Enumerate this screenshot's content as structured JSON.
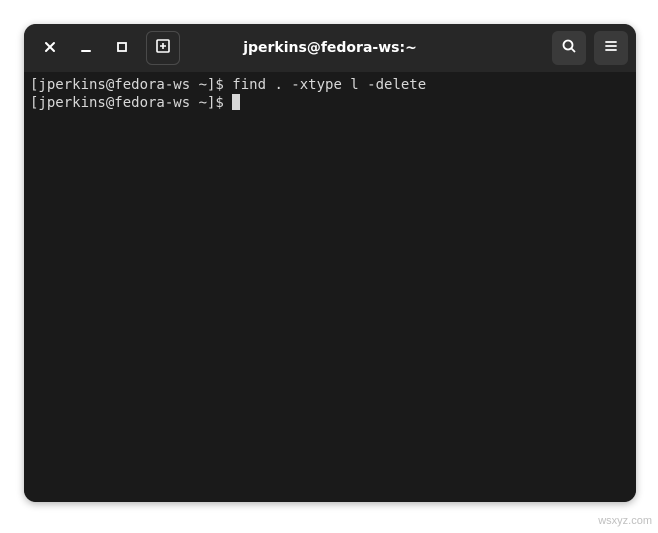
{
  "window": {
    "title": "jperkins@fedora-ws:~"
  },
  "terminal": {
    "lines": [
      {
        "prompt": "[jperkins@fedora-ws ~]$ ",
        "command": "find . -xtype l -delete"
      },
      {
        "prompt": "[jperkins@fedora-ws ~]$ ",
        "command": ""
      }
    ]
  },
  "watermark": "wsxyz.com"
}
